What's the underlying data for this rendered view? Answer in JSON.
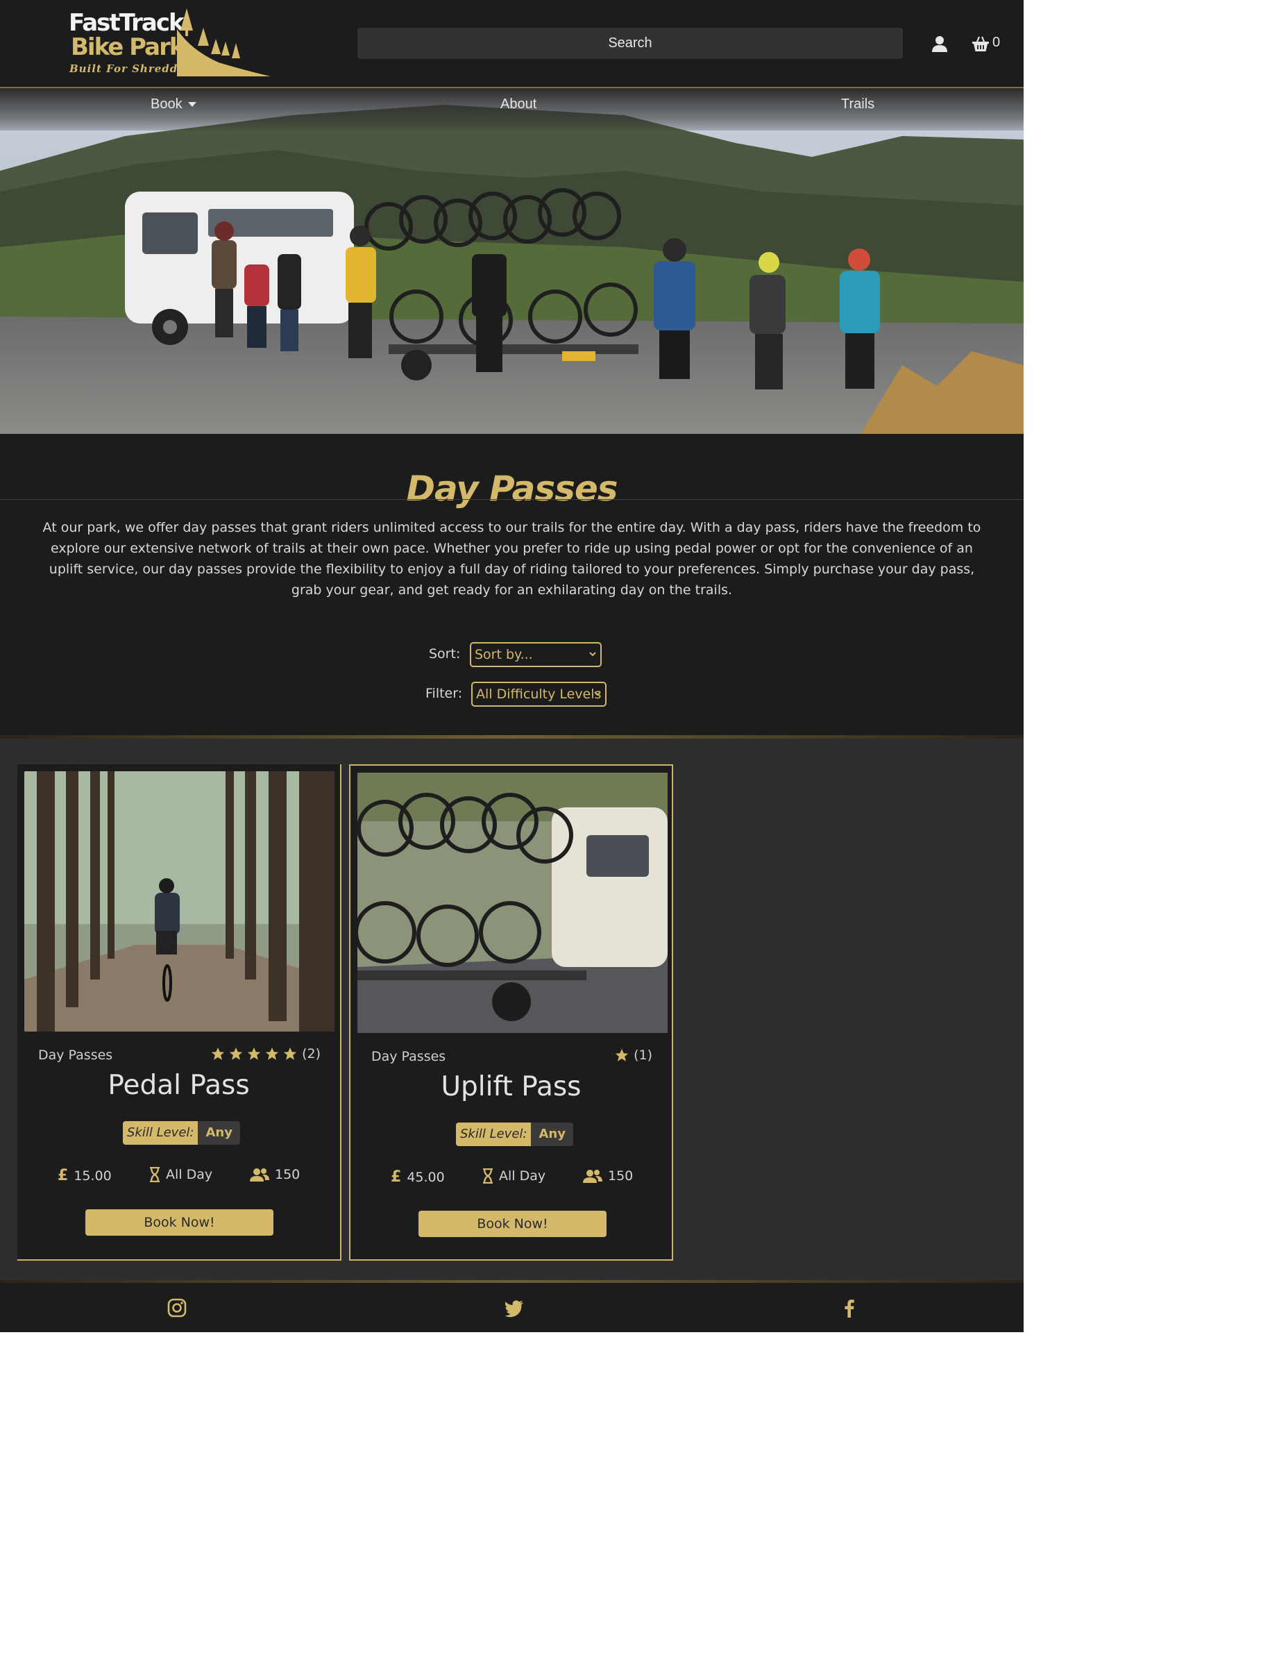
{
  "brand": {
    "name_line1": "FastTrack",
    "name_line2": "Bike Park",
    "tagline": "Built For Shredding"
  },
  "header": {
    "search_placeholder": "Search",
    "account_icon": "user-icon",
    "basket_icon": "basket-icon",
    "basket_count": "0"
  },
  "nav": {
    "items": [
      {
        "label": "Book",
        "has_dropdown": true
      },
      {
        "label": "About"
      },
      {
        "label": "Trails"
      }
    ]
  },
  "intro": {
    "title": "Day Passes",
    "text": "At our park, we offer day passes that grant riders unlimited access to our trails for the entire day. With a day pass, riders have the freedom to explore our extensive network of trails at their own pace. Whether you prefer to ride up using pedal power or opt for the convenience of an uplift service, our day passes provide the flexibility to enjoy a full day of riding tailored to your preferences. Simply purchase your day pass, grab your gear, and get ready for an exhilarating day on the trails."
  },
  "controls": {
    "sort_label": "Sort:",
    "sort_value": "Sort by...",
    "filter_label": "Filter:",
    "filter_value": "All Difficulty Levels"
  },
  "products": [
    {
      "category": "Day Passes",
      "name": "Pedal Pass",
      "rating_stars": 5,
      "rating_count": "(2)",
      "skill_label": "Skill Level:",
      "skill_value": "Any",
      "currency_symbol": "£",
      "price": "15.00",
      "duration": "All Day",
      "capacity": "150",
      "button": "Book Now!"
    },
    {
      "category": "Day Passes",
      "name": "Uplift Pass",
      "rating_stars": 1,
      "rating_count": "(1)",
      "skill_label": "Skill Level:",
      "skill_value": "Any",
      "currency_symbol": "£",
      "price": "45.00",
      "duration": "All Day",
      "capacity": "150",
      "button": "Book Now!"
    }
  ],
  "footer": {
    "icons": [
      "instagram-icon",
      "twitter-icon",
      "facebook-icon"
    ]
  },
  "colors": {
    "accent": "#d4b96a",
    "background": "#1c1c1c",
    "panel": "#2e2e2e",
    "text": "#d8d8d8"
  }
}
